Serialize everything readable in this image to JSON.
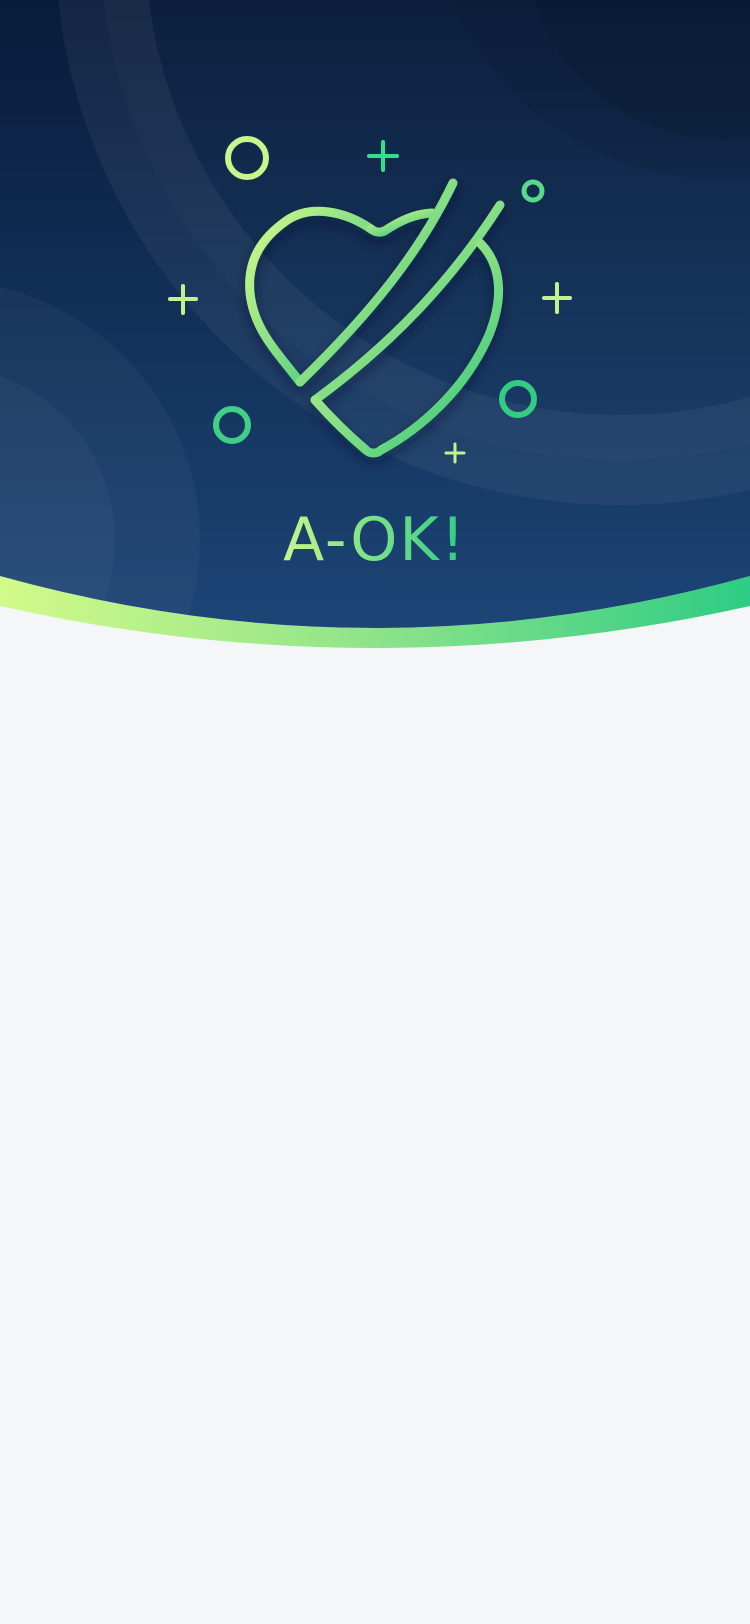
{
  "app": {
    "title": "A-OK!"
  },
  "colors": {
    "background": "#f4f6f8",
    "hero_top": "#081b3a",
    "hero_bottom": "#1d4779",
    "accent_light": "#c8f78c",
    "accent_green": "#2ecc7f"
  },
  "icons": {
    "logo": "heart-with-checkmark-icon",
    "sparkles": [
      "circle-sparkle",
      "plus-sparkle"
    ]
  }
}
